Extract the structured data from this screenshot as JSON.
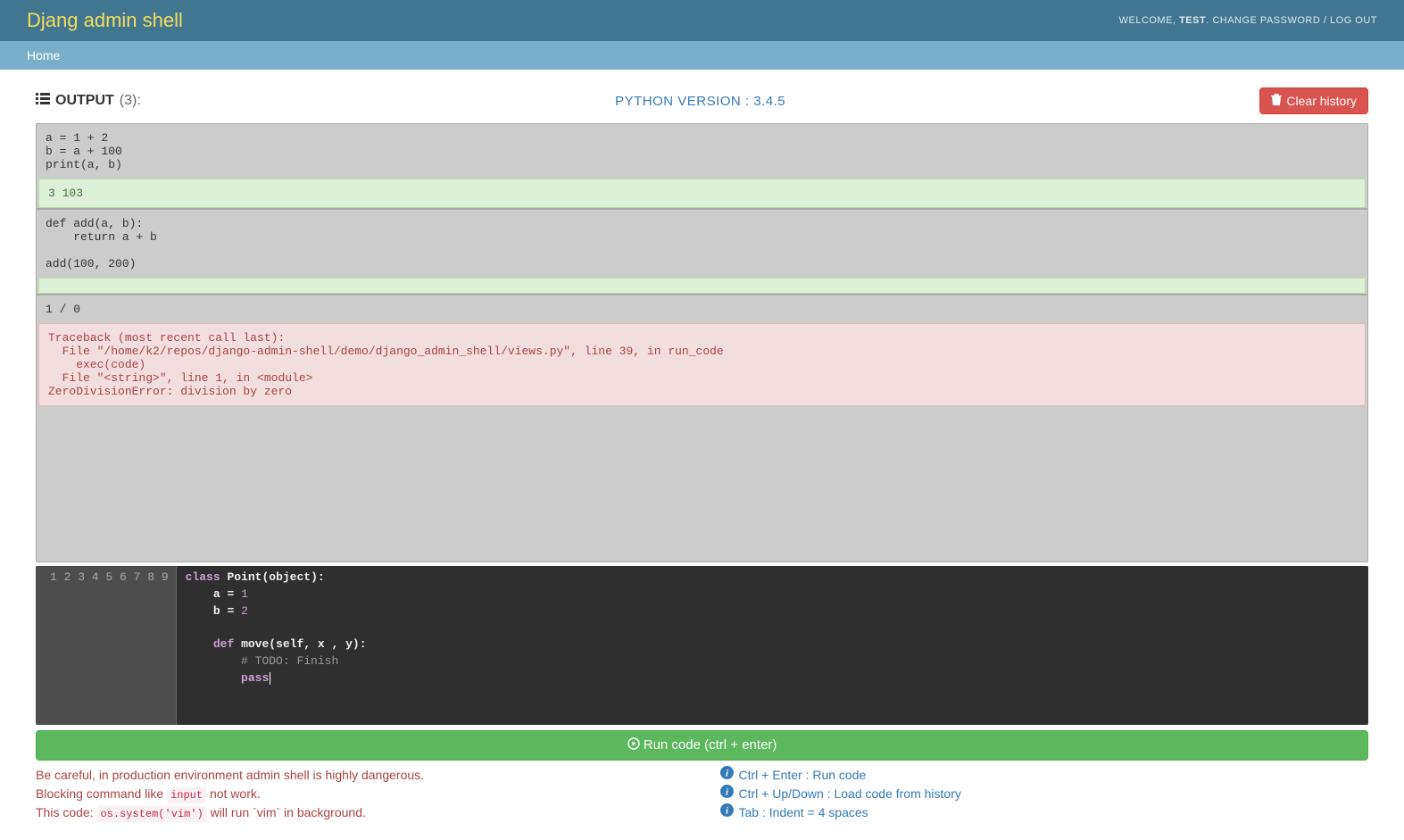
{
  "header": {
    "title": "Djang admin shell",
    "welcome": "WELCOME,",
    "user": "TEST",
    "change_password": "CHANGE PASSWORD",
    "logout": "LOG OUT",
    "home": "Home"
  },
  "toolbar": {
    "output_label": "OUTPUT",
    "count": "(3):",
    "python_version": "PYTHON VERSION : 3.4.5",
    "clear_history": "Clear history"
  },
  "history": [
    {
      "code": "a = 1 + 2\nb = a + 100\nprint(a, b)",
      "status": "success",
      "output": "3 103"
    },
    {
      "code": "def add(a, b):\n    return a + b\n\nadd(100, 200)",
      "status": "success",
      "output": ""
    },
    {
      "code": "1 / 0",
      "status": "error",
      "output": "Traceback (most recent call last):\n  File \"/home/k2/repos/django-admin-shell/demo/django_admin_shell/views.py\", line 39, in run_code\n    exec(code)\n  File \"<string>\", line 1, in <module>\nZeroDivisionError: division by zero"
    }
  ],
  "editor": {
    "line_numbers": [
      "1",
      "2",
      "3",
      "4",
      "5",
      "6",
      "7",
      "8",
      "9"
    ],
    "tokens": [
      [
        {
          "c": "kw",
          "t": "class"
        },
        {
          "c": "",
          "t": " "
        },
        {
          "c": "cls",
          "t": "Point"
        },
        {
          "c": "plain",
          "t": "(object):"
        }
      ],
      [
        {
          "c": "",
          "t": "    "
        },
        {
          "c": "plain",
          "t": "a = "
        },
        {
          "c": "num",
          "t": "1"
        }
      ],
      [
        {
          "c": "",
          "t": "    "
        },
        {
          "c": "plain",
          "t": "b = "
        },
        {
          "c": "num",
          "t": "2"
        }
      ],
      [],
      [
        {
          "c": "",
          "t": "    "
        },
        {
          "c": "kw",
          "t": "def"
        },
        {
          "c": "",
          "t": " "
        },
        {
          "c": "fn",
          "t": "move"
        },
        {
          "c": "plain",
          "t": "(self, x , y):"
        }
      ],
      [
        {
          "c": "",
          "t": "        "
        },
        {
          "c": "cm",
          "t": "# TODO: Finish"
        }
      ],
      [
        {
          "c": "",
          "t": "        "
        },
        {
          "c": "kw",
          "t": "pass"
        },
        {
          "c": "cursor",
          "t": ""
        }
      ],
      [],
      []
    ]
  },
  "run_button": "Run code (ctrl + enter)",
  "footer": {
    "warn_line1": "Be careful, in production environment admin shell is highly dangerous.",
    "warn_line2_a": "Blocking command like ",
    "warn_line2_code": "input",
    "warn_line2_b": " not work.",
    "warn_line3_a": "This code: ",
    "warn_line3_code": "os.system('vim')",
    "warn_line3_b": " will run `vim` in background.",
    "hints": [
      "Ctrl + Enter : Run code",
      "Ctrl + Up/Down : Load code from history",
      "Tab : Indent = 4 spaces"
    ]
  }
}
